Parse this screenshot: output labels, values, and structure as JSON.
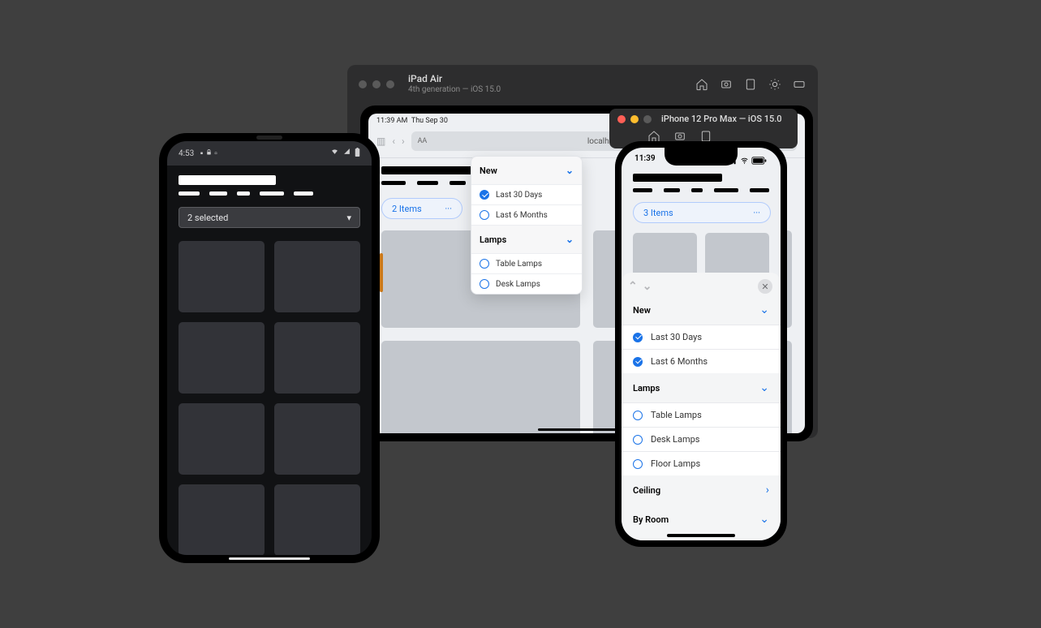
{
  "ipad": {
    "sim_title": "iPad Air",
    "sim_subtitle": "4th generation — iOS 15.0",
    "status_time": "11:39 AM",
    "status_date": "Thu Sep 30",
    "url": "localhost",
    "chip_label": "2 Items",
    "chip_dots": "···"
  },
  "ipad_popover": {
    "sections": {
      "new": {
        "title": "New",
        "items": {
          "a": "Last 30 Days",
          "b": "Last 6 Months"
        }
      },
      "lamps": {
        "title": "Lamps",
        "items": {
          "a": "Table Lamps",
          "b": "Desk Lamps"
        }
      }
    }
  },
  "iphone": {
    "sim_title": "iPhone 12 Pro Max — iOS 15.0",
    "status_time": "11:39",
    "chip_label": "3 Items",
    "chip_dots": "···"
  },
  "sheet": {
    "sections": {
      "new": {
        "title": "New",
        "items": {
          "a": "Last 30 Days",
          "b": "Last 6 Months"
        }
      },
      "lamps": {
        "title": "Lamps",
        "items": {
          "a": "Table Lamps",
          "b": "Desk Lamps",
          "c": "Floor Lamps"
        }
      },
      "ceiling": {
        "title": "Ceiling"
      },
      "byroom": {
        "title": "By Room"
      }
    }
  },
  "pixel": {
    "status_time": "4:53",
    "select_label": "2 selected"
  }
}
